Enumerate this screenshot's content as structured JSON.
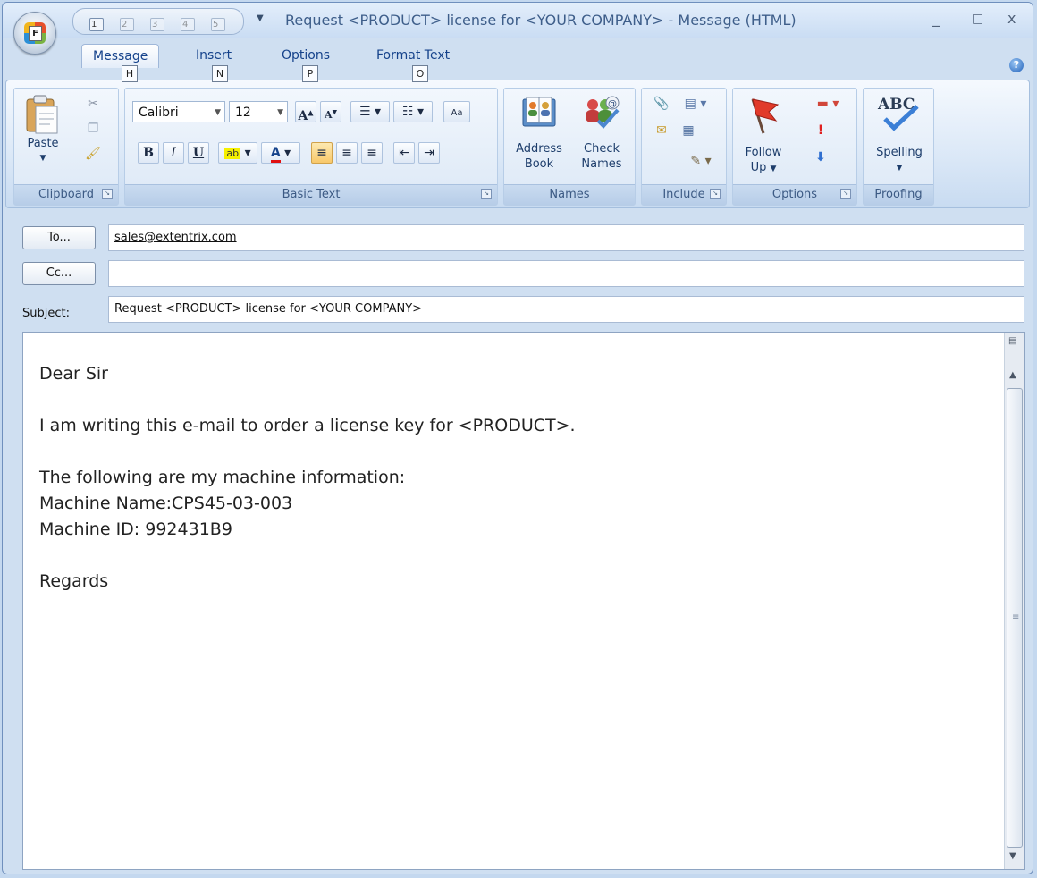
{
  "window": {
    "title": "Request <PRODUCT> license for <YOUR COMPANY> - Message (HTML)"
  },
  "office_button": {
    "keytip": "F"
  },
  "qat": {
    "items": [
      {
        "key": "1",
        "icon": "save-icon"
      },
      {
        "key": "2",
        "icon": "undo-icon"
      },
      {
        "key": "3",
        "icon": "redo-icon"
      },
      {
        "key": "4",
        "icon": "previous-item-icon"
      },
      {
        "key": "5",
        "icon": "next-item-icon"
      }
    ]
  },
  "window_controls": {
    "minimize": "_",
    "maximize": "□",
    "close": "x"
  },
  "tabs": [
    {
      "label": "Message",
      "keytip": "H",
      "active": true
    },
    {
      "label": "Insert",
      "keytip": "N"
    },
    {
      "label": "Options",
      "keytip": "P"
    },
    {
      "label": "Format Text",
      "keytip": "O"
    }
  ],
  "ribbon": {
    "clipboard": {
      "paste_label": "Paste",
      "group_label": "Clipboard"
    },
    "basic_text": {
      "font_name": "Calibri",
      "font_size": "12",
      "bold": "B",
      "italic": "I",
      "underline": "U",
      "font_color_glyph": "A",
      "group_label": "Basic Text"
    },
    "names": {
      "address_book_line1": "Address",
      "address_book_line2": "Book",
      "check_names_line1": "Check",
      "check_names_line2": "Names",
      "group_label": "Names"
    },
    "include": {
      "group_label": "Include"
    },
    "options": {
      "follow_up_line1": "Follow",
      "follow_up_line2": "Up",
      "group_label": "Options"
    },
    "proofing": {
      "spelling_glyph": "ABC",
      "spelling_label": "Spelling",
      "group_label": "Proofing"
    }
  },
  "header": {
    "to_button": "To...",
    "to_value": "sales@extentrix.com",
    "cc_button": "Cc...",
    "cc_value": "",
    "subject_label": "Subject:",
    "subject_value": "Request <PRODUCT> license for <YOUR COMPANY>"
  },
  "body": {
    "lines": [
      "Dear Sir",
      "",
      "I am writing this e-mail to order a license key for <PRODUCT>.",
      "",
      "The following are my machine information:",
      "Machine Name:CPS45-03-003",
      "Machine ID: 992431B9",
      "",
      "Regards"
    ]
  },
  "colors": {
    "accent": "#15428b",
    "ribbon_bg": "#dbe8f7",
    "highlight_active": "#f8c86a"
  }
}
